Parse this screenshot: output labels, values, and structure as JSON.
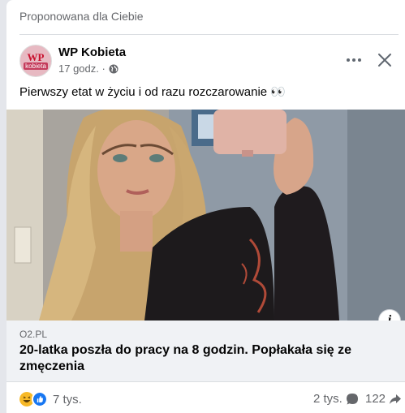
{
  "feed": {
    "suggested_label": "Proponowana dla Ciebie"
  },
  "post": {
    "author": {
      "name": "WP Kobieta",
      "avatar_text_top": "WP",
      "avatar_text_bottom": "kobieta"
    },
    "timestamp": "17 godz. ·",
    "privacy_icon": "globe-icon",
    "text": "Pierwszy etat w życiu i od razu rozczarowanie 👀",
    "actions": {
      "more_icon": "more-dots-icon",
      "close_icon": "close-icon"
    }
  },
  "link_preview": {
    "domain": "O2.PL",
    "title": "20-latka poszła do pracy na 8 godzin. Popłakała się ze zmęczenia",
    "info_label": "i"
  },
  "stats": {
    "reactions_count": "7 tys.",
    "reaction_types": [
      "haha",
      "like"
    ],
    "comments_count": "2 tys.",
    "shares_count": "122"
  },
  "colors": {
    "background": "#e4e6eb",
    "card": "#ffffff",
    "secondary_text": "#65676b",
    "link_box": "#f0f2f5",
    "like_blue": "#1877f2",
    "haha_yellow": "#f7b928"
  }
}
